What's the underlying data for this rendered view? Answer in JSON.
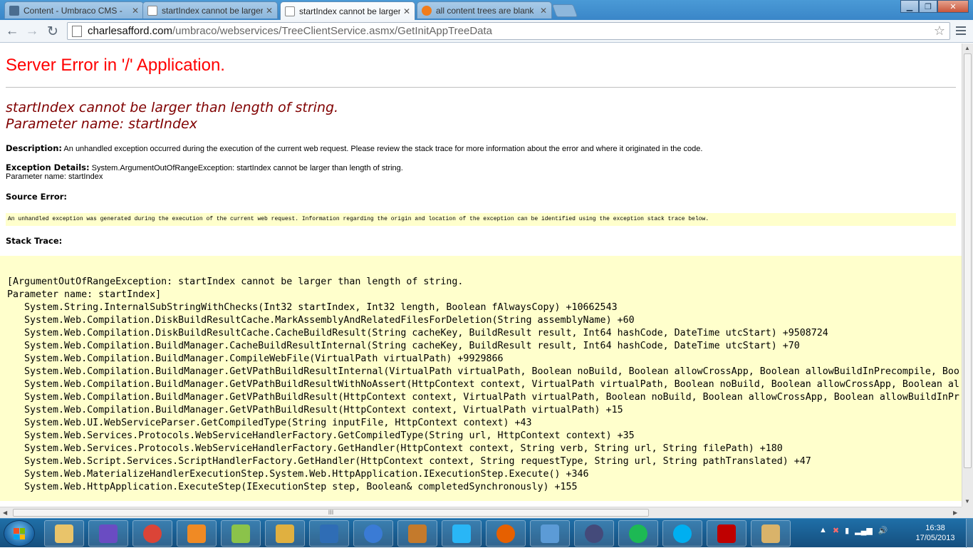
{
  "browser": {
    "tabs": [
      {
        "label": "Content - Umbraco CMS - ",
        "active": false
      },
      {
        "label": "startIndex cannot be larger",
        "active": false
      },
      {
        "label": "startIndex cannot be larger",
        "active": true
      },
      {
        "label": "all content trees are blank",
        "active": false
      }
    ],
    "window_buttons": {
      "minimize": "▁",
      "restore": "❐",
      "close": "✕"
    },
    "url_host": "charlesafford.com",
    "url_path": "/umbraco/webservices/TreeClientService.asmx/GetInitAppTreeData"
  },
  "page": {
    "title": "Server Error in '/' Application.",
    "message_line1": "startIndex cannot be larger than length of string.",
    "message_line2": "Parameter name: startIndex",
    "description_label": "Description:",
    "description_text": " An unhandled exception occurred during the execution of the current web request. Please review the stack trace for more information about the error and where it originated in the code.",
    "exception_label": "Exception Details:",
    "exception_text": " System.ArgumentOutOfRangeException: startIndex cannot be larger than length of string.",
    "exception_param": "Parameter name: startIndex",
    "source_error_label": "Source Error:",
    "source_error_text": "An unhandled exception was generated during the execution of the current web request. Information regarding the origin and location of the exception can be identified using the exception stack trace below.",
    "stack_trace_label": "Stack Trace:",
    "stack_trace_lines": [
      "[ArgumentOutOfRangeException: startIndex cannot be larger than length of string.",
      "Parameter name: startIndex]",
      "   System.String.InternalSubStringWithChecks(Int32 startIndex, Int32 length, Boolean fAlwaysCopy) +10662543",
      "   System.Web.Compilation.DiskBuildResultCache.MarkAssemblyAndRelatedFilesForDeletion(String assemblyName) +60",
      "   System.Web.Compilation.DiskBuildResultCache.CacheBuildResult(String cacheKey, BuildResult result, Int64 hashCode, DateTime utcStart) +9508724",
      "   System.Web.Compilation.BuildManager.CacheBuildResultInternal(String cacheKey, BuildResult result, Int64 hashCode, DateTime utcStart) +70",
      "   System.Web.Compilation.BuildManager.CompileWebFile(VirtualPath virtualPath) +9929866",
      "   System.Web.Compilation.BuildManager.GetVPathBuildResultInternal(VirtualPath virtualPath, Boolean noBuild, Boolean allowCrossApp, Boolean allowBuildInPrecompile, Boo",
      "   System.Web.Compilation.BuildManager.GetVPathBuildResultWithNoAssert(HttpContext context, VirtualPath virtualPath, Boolean noBuild, Boolean allowCrossApp, Boolean al",
      "   System.Web.Compilation.BuildManager.GetVPathBuildResult(HttpContext context, VirtualPath virtualPath, Boolean noBuild, Boolean allowCrossApp, Boolean allowBuildInPr",
      "   System.Web.Compilation.BuildManager.GetVPathBuildResult(HttpContext context, VirtualPath virtualPath) +15",
      "   System.Web.UI.WebServiceParser.GetCompiledType(String inputFile, HttpContext context) +43",
      "   System.Web.Services.Protocols.WebServiceHandlerFactory.GetCompiledType(String url, HttpContext context) +35",
      "   System.Web.Services.Protocols.WebServiceHandlerFactory.GetHandler(HttpContext context, String verb, String url, String filePath) +180",
      "   System.Web.Script.Services.ScriptHandlerFactory.GetHandler(HttpContext context, String requestType, String url, String pathTranslated) +47",
      "   System.Web.MaterializeHandlerExecutionStep.System.Web.HttpApplication.IExecutionStep.Execute() +346",
      "   System.Web.HttpApplication.ExecuteStep(IExecutionStep step, Boolean& completedSynchronously) +155"
    ]
  },
  "scrollbar": {
    "h_thumb_grip": "III"
  },
  "taskbar": {
    "apps": [
      {
        "name": "explorer",
        "color": "#e9c46a"
      },
      {
        "name": "visual-studio",
        "color": "#6a4cc2"
      },
      {
        "name": "chrome",
        "color": "#db4437"
      },
      {
        "name": "media-player",
        "color": "#f08a24"
      },
      {
        "name": "notepad-plus-plus",
        "color": "#8bc34a"
      },
      {
        "name": "tools",
        "color": "#e0b040"
      },
      {
        "name": "shield",
        "color": "#2f6db5"
      },
      {
        "name": "thunderbird",
        "color": "#3a7bd5"
      },
      {
        "name": "guitar-app",
        "color": "#c47a2c"
      },
      {
        "name": "flash",
        "color": "#29b6f6"
      },
      {
        "name": "firefox",
        "color": "#e66000"
      },
      {
        "name": "network-app",
        "color": "#5c9bd6"
      },
      {
        "name": "keepass",
        "color": "#444a7a"
      },
      {
        "name": "spotify",
        "color": "#1db954"
      },
      {
        "name": "skype",
        "color": "#00aff0"
      },
      {
        "name": "filezilla",
        "color": "#bf0000"
      },
      {
        "name": "paint",
        "color": "#d9b36a"
      }
    ],
    "tray_icons": [
      "▲",
      "✖",
      "▮",
      "▂▄▆",
      "🔊"
    ],
    "time": "16:38",
    "date": "17/05/2013"
  }
}
